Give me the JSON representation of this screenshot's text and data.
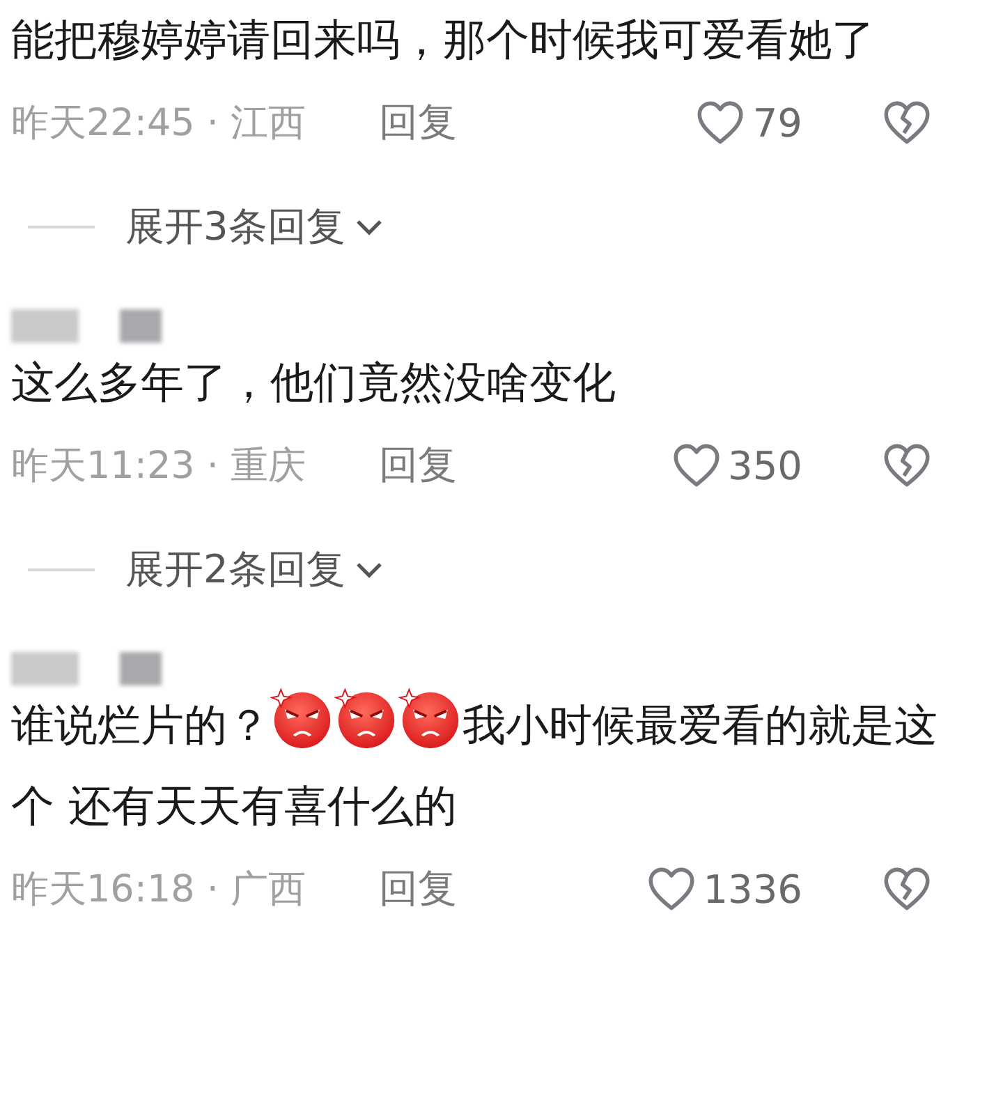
{
  "comments": [
    {
      "body": [
        {
          "kind": "text",
          "text": "能把穆婷婷请回来吗，那个时候我可爱看她了"
        }
      ],
      "meta": "昨天22:45 · 江西",
      "reply": "回复",
      "likes": "79",
      "expand": "展开3条回复"
    },
    {
      "author": {
        "kind": "redacted"
      },
      "body": [
        {
          "kind": "text",
          "text": "这么多年了，他们竟然没啥变化"
        }
      ],
      "meta": "昨天11:23 · 重庆",
      "reply": "回复",
      "likes": "350",
      "expand": "展开2条回复"
    },
    {
      "author": {
        "kind": "redacted"
      },
      "body": [
        {
          "kind": "text",
          "text": "谁说烂片的？"
        },
        {
          "kind": "emoji"
        },
        {
          "kind": "emoji"
        },
        {
          "kind": "emoji"
        },
        {
          "kind": "text",
          "text": "我小时候最爱看的就是这个 还有天天有喜什么的"
        }
      ],
      "meta": "昨天16:18 · 广西",
      "reply": "回复",
      "likes": "1336"
    }
  ]
}
